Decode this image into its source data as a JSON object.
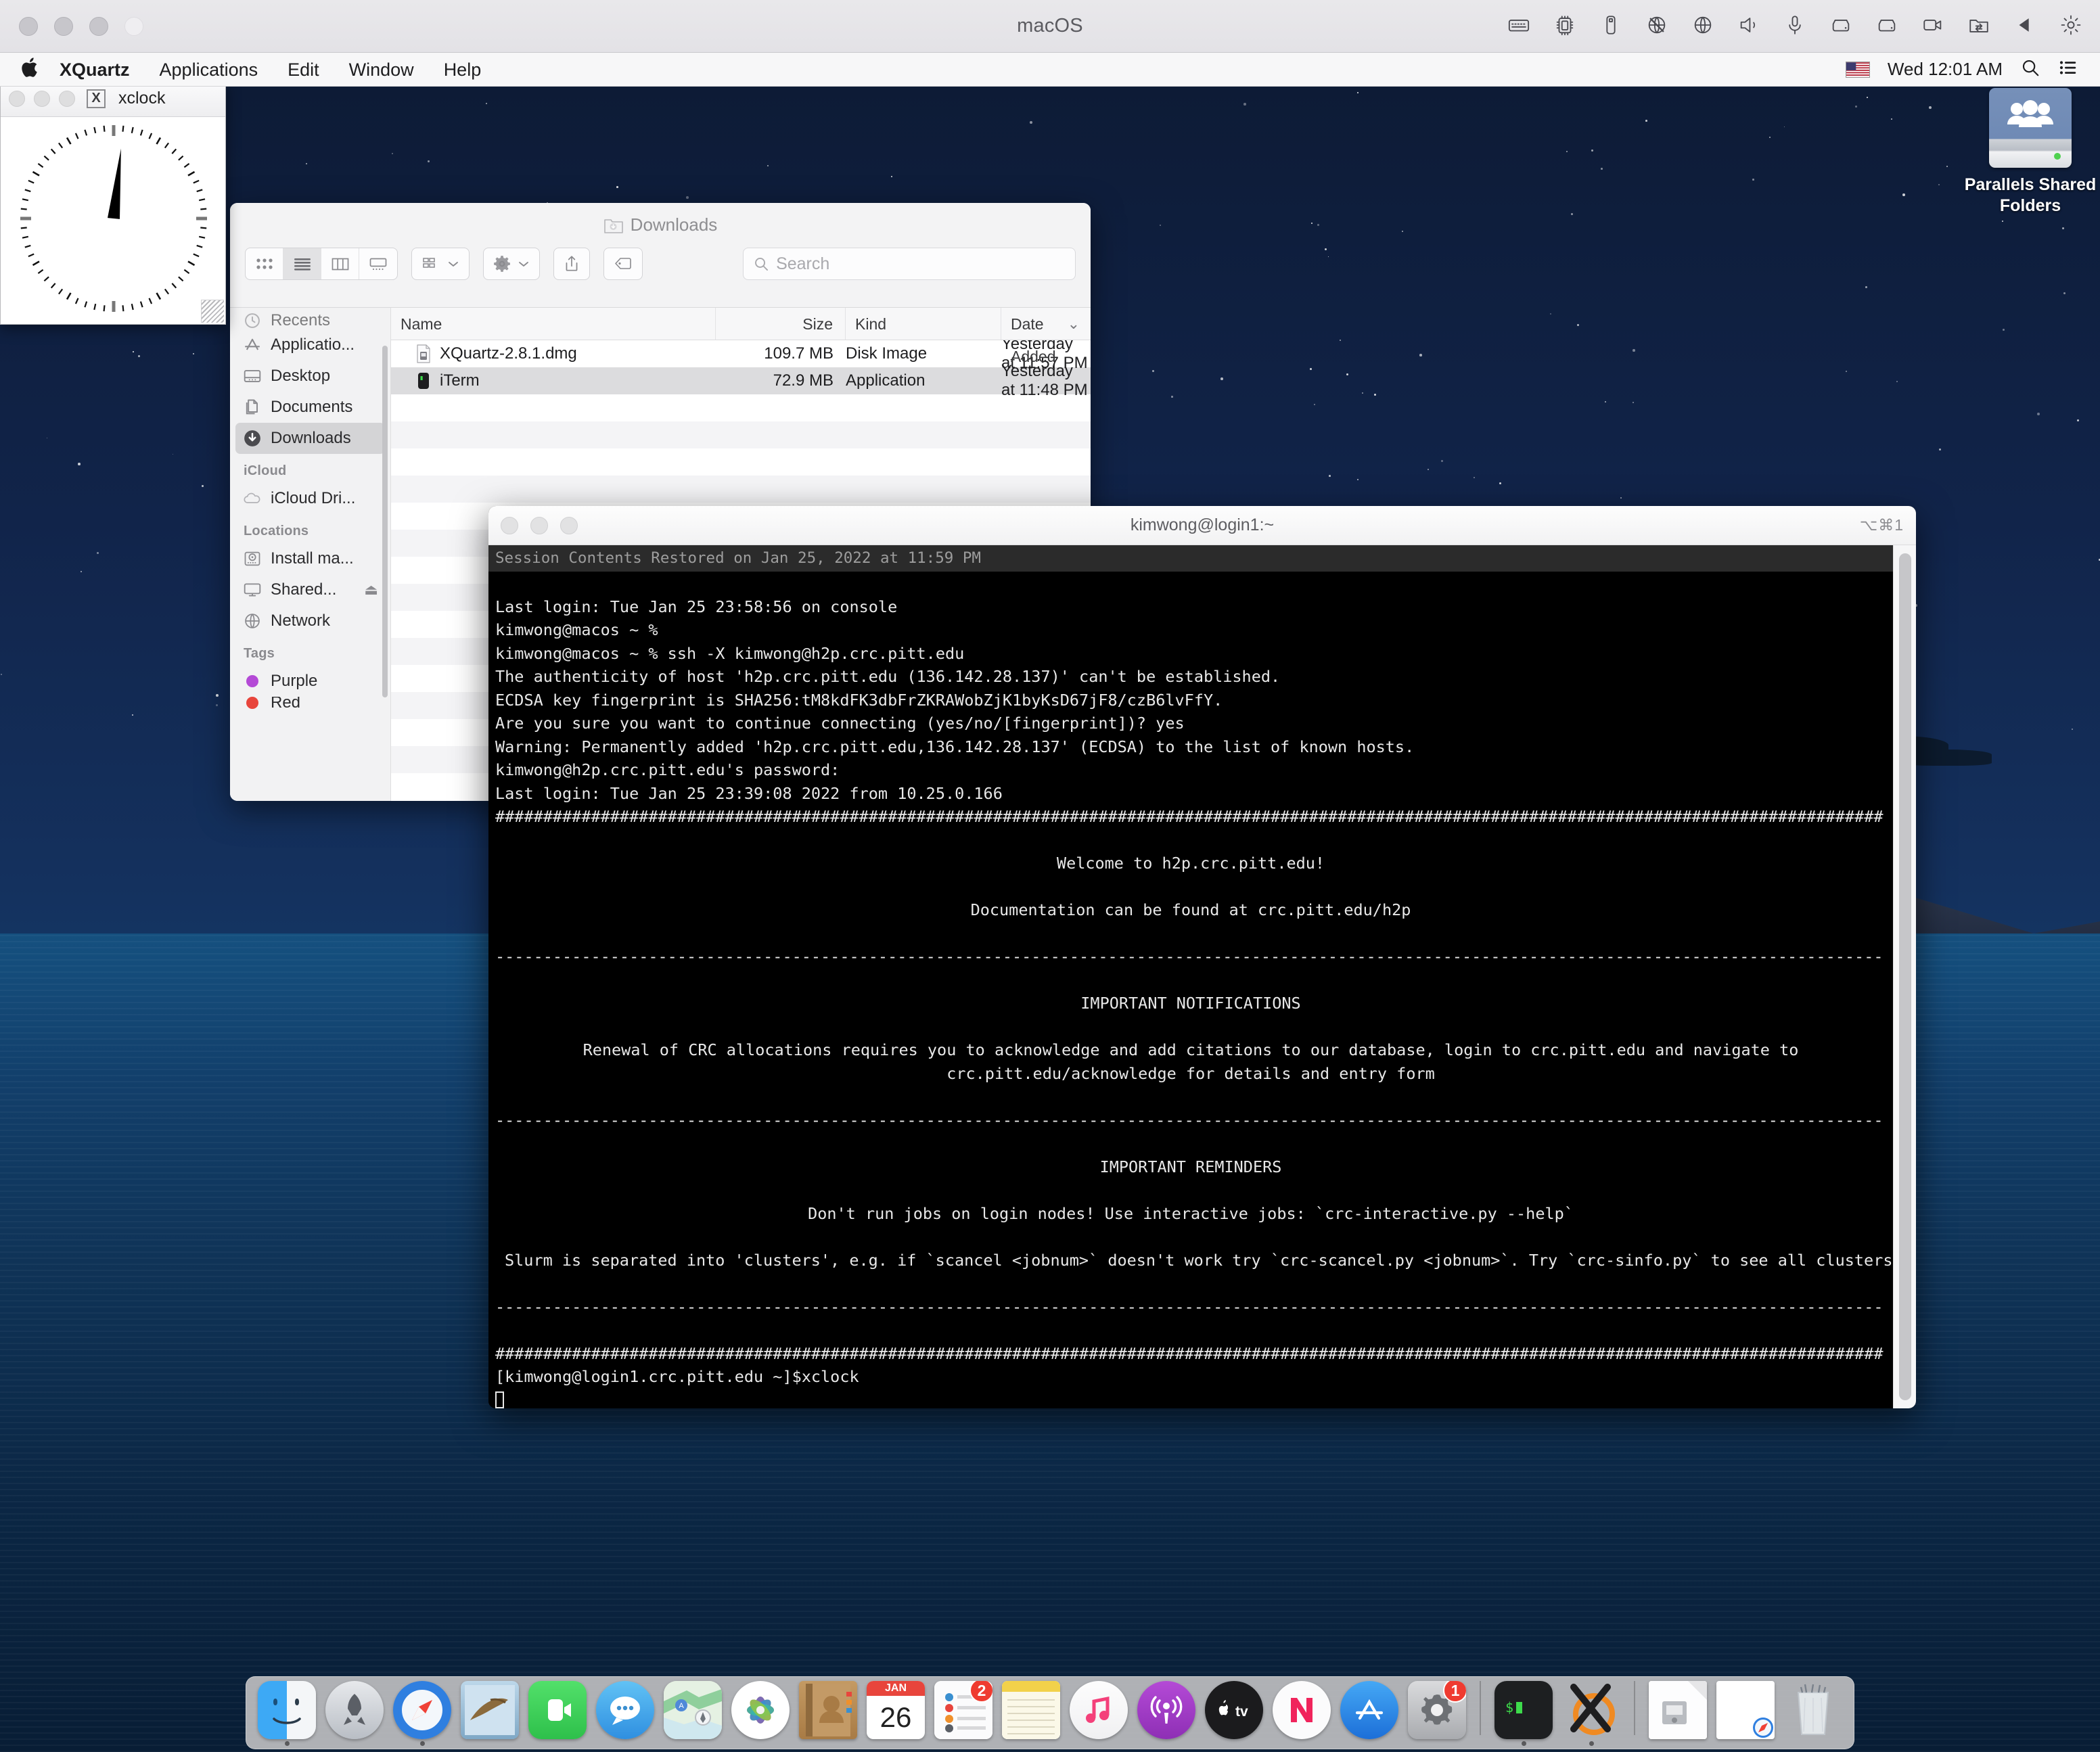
{
  "vm": {
    "title": "macOS",
    "status_icons": [
      "keyboard-icon",
      "cpu-icon",
      "usb-icon",
      "no-network-icon",
      "globe-icon",
      "speaker-icon",
      "microphone-icon",
      "disk-icon",
      "disk2-icon",
      "camera-icon",
      "shared-folder-icon",
      "play-icon",
      "gear-icon"
    ]
  },
  "menubar": {
    "apple": "apple-logo",
    "items": [
      {
        "label": "XQuartz",
        "bold": true
      },
      {
        "label": "Applications",
        "bold": false
      },
      {
        "label": "Edit",
        "bold": false
      },
      {
        "label": "Window",
        "bold": false
      },
      {
        "label": "Help",
        "bold": false
      }
    ],
    "clock": "Wed 12:01 AM",
    "flag": "us-flag-icon",
    "search_icon": "spotlight-search-icon",
    "control_center_icon": "control-center-icon"
  },
  "desktop": {
    "icon": {
      "label_line1": "Parallels Shared",
      "label_line2": "Folders",
      "icon": "shared-drive-icon"
    }
  },
  "xclock": {
    "title": "xclock",
    "badge": "X",
    "hour_angle_deg": 0,
    "minute_angle_deg": 6
  },
  "finder": {
    "title": "Downloads",
    "view_modes": [
      "icon-view",
      "list-view",
      "column-view",
      "gallery-view"
    ],
    "active_view": "list-view",
    "toolbar_buttons": [
      "group-by-button",
      "action-gear-button",
      "share-button",
      "tags-button"
    ],
    "search": {
      "placeholder": "Search",
      "value": ""
    },
    "sidebar": {
      "top_partial": "Recents",
      "favorites": [
        {
          "label": "Applicatio...",
          "icon": "applications-icon",
          "selected": false
        },
        {
          "label": "Desktop",
          "icon": "desktop-icon",
          "selected": false
        },
        {
          "label": "Documents",
          "icon": "documents-icon",
          "selected": false
        },
        {
          "label": "Downloads",
          "icon": "downloads-icon",
          "selected": true
        }
      ],
      "icloud_header": "iCloud",
      "icloud": [
        {
          "label": "iCloud Dri...",
          "icon": "icloud-icon"
        }
      ],
      "locations_header": "Locations",
      "locations": [
        {
          "label": "Install ma...",
          "icon": "disk-icon",
          "eject": false
        },
        {
          "label": "Shared...",
          "icon": "display-icon",
          "eject": true
        },
        {
          "label": "Network",
          "icon": "network-globe-icon",
          "eject": false
        }
      ],
      "tags_header": "Tags",
      "tags": [
        {
          "label": "Purple",
          "color": "#b44ad6"
        },
        {
          "label": "Red",
          "color": "#e8453c"
        }
      ]
    },
    "columns": [
      "Name",
      "Size",
      "Kind",
      "Date Added"
    ],
    "sort_column": "Date Added",
    "rows": [
      {
        "name": "XQuartz-2.8.1.dmg",
        "size": "109.7 MB",
        "kind": "Disk Image",
        "date": "Yesterday at 11:57 PM",
        "icon": "dmg-file-icon",
        "selected": false
      },
      {
        "name": "iTerm",
        "size": "72.9 MB",
        "kind": "Application",
        "date": "Yesterday at 11:48 PM",
        "icon": "iterm-app-icon",
        "selected": true
      }
    ]
  },
  "terminal": {
    "title": "kimwong@login1:~",
    "shortcut": "⌥⌘1",
    "restored_banner": "Session Contents Restored on Jan 25, 2022 at 11:59 PM",
    "lines": [
      "",
      "Last login: Tue Jan 25 23:58:56 on console",
      "kimwong@macos ~ %",
      "kimwong@macos ~ % ssh -X kimwong@h2p.crc.pitt.edu",
      "The authenticity of host 'h2p.crc.pitt.edu (136.142.28.137)' can't be established.",
      "ECDSA key fingerprint is SHA256:tM8kdFK3dbFrZKRAWobZjK1byKsD67jF8/czB6lvFfY.",
      "Are you sure you want to continue connecting (yes/no/[fingerprint])? yes",
      "Warning: Permanently added 'h2p.crc.pitt.edu,136.142.28.137' (ECDSA) to the list of known hosts.",
      "kimwong@h2p.crc.pitt.edu's password:",
      "Last login: Tue Jan 25 23:39:08 2022 from 10.25.0.166"
    ],
    "hash_rule": "#",
    "dash_rule": "-",
    "welcome": "Welcome to h2p.crc.pitt.edu!",
    "documentation": "Documentation can be found at crc.pitt.edu/h2p",
    "notifications_header": "IMPORTANT NOTIFICATIONS",
    "notifications_body_1": "Renewal of CRC allocations requires you to acknowledge and add citations to our database, login to crc.pitt.edu and navigate to",
    "notifications_body_2": "crc.pitt.edu/acknowledge for details and entry form",
    "reminders_header": "IMPORTANT REMINDERS",
    "reminders_body_1": "Don't run jobs on login nodes! Use interactive jobs: `crc-interactive.py --help`",
    "reminders_body_2": "Slurm is separated into 'clusters', e.g. if `scancel <jobnum>` doesn't work try `crc-scancel.py <jobnum>`. Try `crc-sinfo.py` to see all clusters.",
    "prompt": "[kimwong@login1.crc.pitt.edu ~]$xclock"
  },
  "dock": {
    "items": [
      {
        "name": "finder",
        "icon": "finder-icon",
        "running": true,
        "badge": ""
      },
      {
        "name": "launchpad",
        "icon": "launchpad-icon",
        "running": false,
        "badge": ""
      },
      {
        "name": "safari",
        "icon": "safari-icon",
        "running": true,
        "badge": ""
      },
      {
        "name": "mail",
        "icon": "mail-icon",
        "running": false,
        "badge": ""
      },
      {
        "name": "facetime",
        "icon": "facetime-icon",
        "running": false,
        "badge": ""
      },
      {
        "name": "messages",
        "icon": "messages-icon",
        "running": false,
        "badge": ""
      },
      {
        "name": "maps",
        "icon": "maps-icon",
        "running": false,
        "badge": ""
      },
      {
        "name": "photos",
        "icon": "photos-icon",
        "running": false,
        "badge": ""
      },
      {
        "name": "contacts",
        "icon": "contacts-icon",
        "running": false,
        "badge": ""
      },
      {
        "name": "calendar",
        "icon": "calendar-icon",
        "running": false,
        "badge": "",
        "month": "JAN",
        "day": "26"
      },
      {
        "name": "reminders",
        "icon": "reminders-icon",
        "running": false,
        "badge": "2"
      },
      {
        "name": "notes",
        "icon": "notes-icon",
        "running": false,
        "badge": ""
      },
      {
        "name": "music",
        "icon": "music-icon",
        "running": false,
        "badge": ""
      },
      {
        "name": "podcasts",
        "icon": "podcasts-icon",
        "running": false,
        "badge": ""
      },
      {
        "name": "appletv",
        "icon": "appletv-icon",
        "running": false,
        "badge": ""
      },
      {
        "name": "news",
        "icon": "news-icon",
        "running": false,
        "badge": ""
      },
      {
        "name": "appstore",
        "icon": "appstore-icon",
        "running": false,
        "badge": ""
      },
      {
        "name": "system-preferences",
        "icon": "system-preferences-icon",
        "running": false,
        "badge": "1"
      },
      {
        "name": "iterm",
        "icon": "iterm-icon",
        "running": true,
        "badge": ""
      },
      {
        "name": "xquartz",
        "icon": "xquartz-icon",
        "running": true,
        "badge": ""
      },
      {
        "name": "installer",
        "icon": "installer-icon",
        "running": false,
        "badge": ""
      },
      {
        "name": "downloads-stack",
        "icon": "downloads-stack-icon",
        "running": false,
        "badge": ""
      },
      {
        "name": "trash",
        "icon": "trash-icon",
        "running": false,
        "badge": ""
      }
    ]
  },
  "colors": {
    "desktop_top": "#0d1b36",
    "desktop_sea": "#14406f",
    "menubar_bg": "#f7f7f8",
    "terminal_bg": "#000000",
    "terminal_fg": "#e8e8e8",
    "finder_selection": "#dcdcde",
    "badge_red": "#ef3b30",
    "tag_purple": "#b44ad6"
  }
}
